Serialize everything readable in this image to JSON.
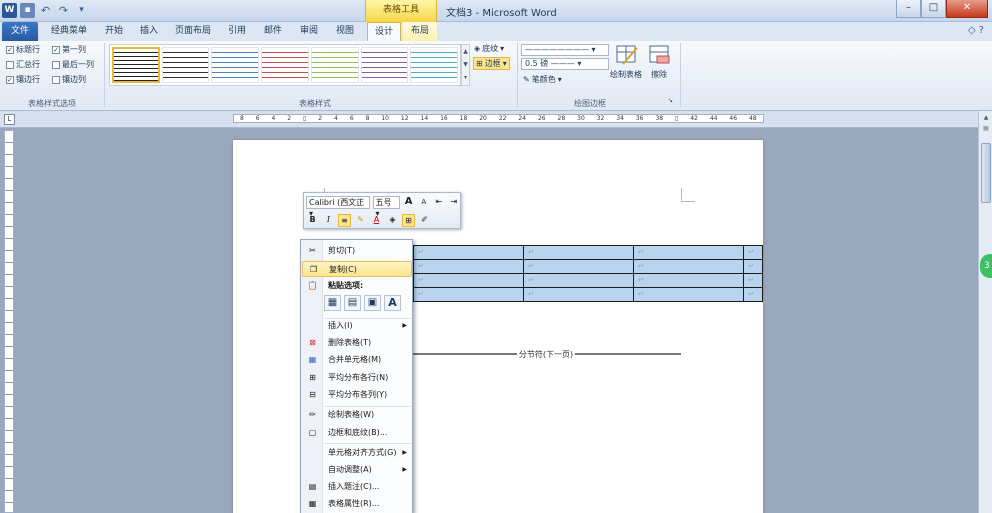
{
  "window": {
    "context_tab_group": "表格工具",
    "title": "文档3 - Microsoft Word",
    "qat_app_letter": "W"
  },
  "tabs": {
    "file": "文件",
    "classic": "经典菜单",
    "home": "开始",
    "insert": "插入",
    "layout": "页面布局",
    "references": "引用",
    "mailings": "邮件",
    "review": "审阅",
    "view": "视图",
    "design": "设计",
    "table_layout": "布局"
  },
  "ribbon": {
    "style_options": {
      "header_row": "标题行",
      "first_column": "第一列",
      "total_row": "汇总行",
      "last_column": "最后一列",
      "banded_rows": "镶边行",
      "banded_columns": "镶边列",
      "group_label": "表格样式选项"
    },
    "table_styles": {
      "group_label": "表格样式",
      "shading": "底纹",
      "borders": "边框"
    },
    "draw_borders": {
      "pen_weight": "0.5 磅",
      "pen_color": "笔颜色",
      "draw_table": "绘制表格",
      "eraser": "擦除",
      "group_label": "绘图边框"
    }
  },
  "ruler": {
    "marks": [
      "8",
      "6",
      "4",
      "2",
      "",
      "2",
      "4",
      "6",
      "8",
      "10",
      "12",
      "14",
      "16",
      "18",
      "20",
      "22",
      "24",
      "26",
      "28",
      "30",
      "32",
      "34",
      "36",
      "38",
      "",
      "42",
      "44",
      "46",
      "48"
    ]
  },
  "mini_toolbar": {
    "font": "Calibri (西文正",
    "size": "五号",
    "grow": "A",
    "shrink": "A",
    "bold": "B",
    "italic": "I"
  },
  "document": {
    "section_break": "分节符(下一页)",
    "cell_mark": "↵"
  },
  "context_menu": {
    "cut": "剪切(T)",
    "copy": "复制(C)",
    "paste_options": "粘贴选项:",
    "insert": "插入(I)",
    "delete_table": "删除表格(T)",
    "merge_cells": "合并单元格(M)",
    "distribute_rows": "平均分布各行(N)",
    "distribute_columns": "平均分布各列(Y)",
    "draw_table": "绘制表格(W)",
    "borders_shading": "边框和底纹(B)...",
    "cell_alignment": "单元格对齐方式(G)",
    "autofit": "自动调整(A)",
    "insert_caption": "插入题注(C)...",
    "table_properties": "表格属性(R)..."
  }
}
